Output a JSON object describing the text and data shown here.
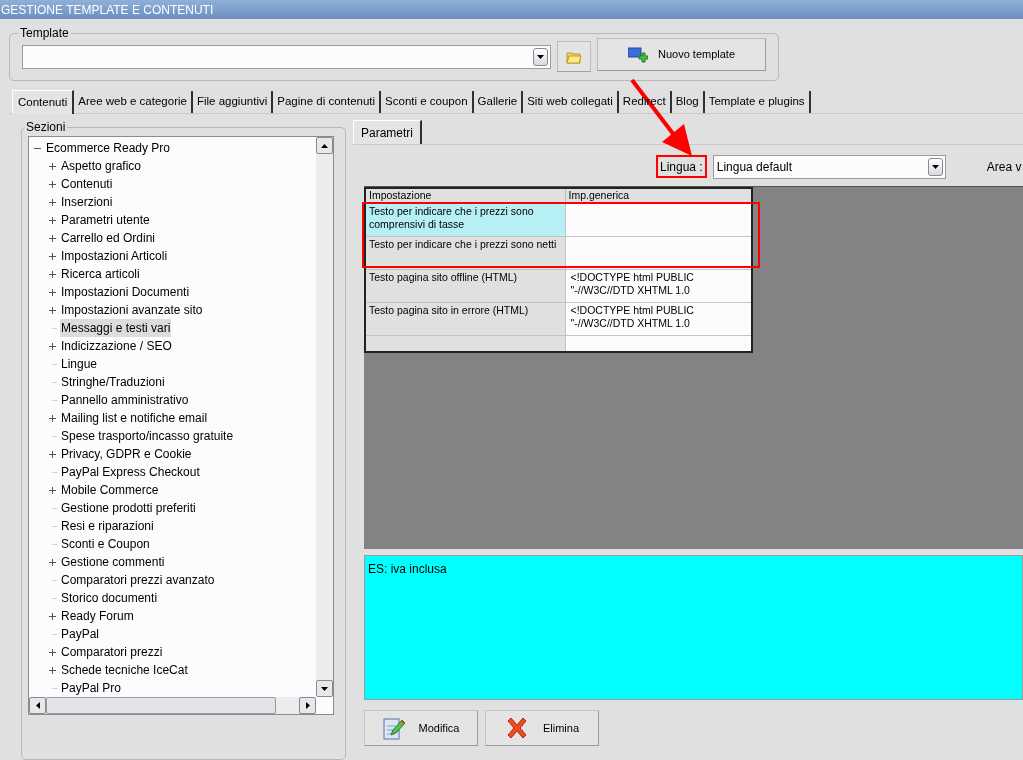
{
  "window": {
    "title": "GESTIONE TEMPLATE E CONTENUTI"
  },
  "template_group": {
    "label": "Template",
    "new_button": "Nuovo template"
  },
  "tabs": [
    {
      "label": "Contenuti",
      "selected": true
    },
    {
      "label": "Aree web e categorie",
      "selected": false
    },
    {
      "label": "File aggiuntivi",
      "selected": false
    },
    {
      "label": "Pagine di contenuti",
      "selected": false
    },
    {
      "label": "Sconti e coupon",
      "selected": false
    },
    {
      "label": "Gallerie",
      "selected": false
    },
    {
      "label": "Siti web collegati",
      "selected": false
    },
    {
      "label": "Redirect",
      "selected": false
    },
    {
      "label": "Blog",
      "selected": false
    },
    {
      "label": "Template e plugins",
      "selected": false
    }
  ],
  "sections": {
    "label": "Sezioni",
    "tree": [
      {
        "label": "Ecommerce Ready Pro",
        "expanded": true,
        "selected": false,
        "children": [
          {
            "label": "Aspetto grafico",
            "expandable": true,
            "selected": false
          },
          {
            "label": "Contenuti",
            "expandable": true,
            "selected": false
          },
          {
            "label": "Inserzioni",
            "expandable": true,
            "selected": false
          },
          {
            "label": "Parametri utente",
            "expandable": true,
            "selected": false
          },
          {
            "label": "Carrello ed Ordini",
            "expandable": true,
            "selected": false
          },
          {
            "label": "Impostazioni Articoli",
            "expandable": true,
            "selected": false
          },
          {
            "label": "Ricerca articoli",
            "expandable": true,
            "selected": false
          },
          {
            "label": "Impostazioni Documenti",
            "expandable": true,
            "selected": false
          },
          {
            "label": "Impostazioni avanzate sito",
            "expandable": true,
            "selected": false
          },
          {
            "label": "Messaggi e testi vari",
            "expandable": false,
            "selected": true
          },
          {
            "label": "Indicizzazione / SEO",
            "expandable": true,
            "selected": false
          },
          {
            "label": "Lingue",
            "expandable": false,
            "selected": false
          },
          {
            "label": "Stringhe/Traduzioni",
            "expandable": false,
            "selected": false
          },
          {
            "label": "Pannello amministrativo",
            "expandable": false,
            "selected": false
          },
          {
            "label": "Mailing list e notifiche email",
            "expandable": true,
            "selected": false
          },
          {
            "label": "Spese trasporto/incasso gratuite",
            "expandable": false,
            "selected": false
          },
          {
            "label": "Privacy, GDPR e Cookie",
            "expandable": true,
            "selected": false
          },
          {
            "label": "PayPal Express Checkout",
            "expandable": false,
            "selected": false
          },
          {
            "label": "Mobile Commerce",
            "expandable": true,
            "selected": false
          },
          {
            "label": "Gestione prodotti preferiti",
            "expandable": false,
            "selected": false
          },
          {
            "label": "Resi e riparazioni",
            "expandable": false,
            "selected": false
          },
          {
            "label": "Sconti e Coupon",
            "expandable": false,
            "selected": false
          },
          {
            "label": "Gestione commenti",
            "expandable": true,
            "selected": false
          },
          {
            "label": "Comparatori prezzi avanzato",
            "expandable": false,
            "selected": false
          },
          {
            "label": "Storico documenti",
            "expandable": false,
            "selected": false
          },
          {
            "label": "Ready Forum",
            "expandable": true,
            "selected": false
          },
          {
            "label": "PayPal",
            "expandable": false,
            "selected": false
          },
          {
            "label": "Comparatori prezzi",
            "expandable": true,
            "selected": false
          },
          {
            "label": "Schede tecniche IceCat",
            "expandable": true,
            "selected": false
          },
          {
            "label": "PayPal Pro",
            "expandable": false,
            "selected": false
          }
        ]
      }
    ]
  },
  "params_tab": {
    "label": "Parametri",
    "selected": true
  },
  "language": {
    "label": "Lingua :",
    "value": "Lingua default",
    "next_label": "Area v"
  },
  "table": {
    "columns": [
      "Impostazione",
      "Imp.generica"
    ],
    "rows": [
      {
        "setting": "Testo per indicare che i prezzi sono comprensivi di tasse",
        "value": "",
        "selected": true
      },
      {
        "setting": "Testo per indicare che i prezzi sono netti",
        "value": "",
        "selected": false
      },
      {
        "setting": "Testo pagina sito offline (HTML)",
        "value": "<!DOCTYPE html PUBLIC \"-//W3C//DTD XHTML 1.0",
        "selected": false
      },
      {
        "setting": "Testo pagina sito in errore (HTML)",
        "value": "<!DOCTYPE html PUBLIC \"-//W3C//DTD XHTML 1.0",
        "selected": false
      },
      {
        "setting": "",
        "value": "",
        "selected": false
      }
    ]
  },
  "description": "ES: iva inclusa",
  "buttons": [
    {
      "kind": "edit",
      "label": "Modifica"
    },
    {
      "kind": "delete",
      "label": "Elimina"
    }
  ]
}
